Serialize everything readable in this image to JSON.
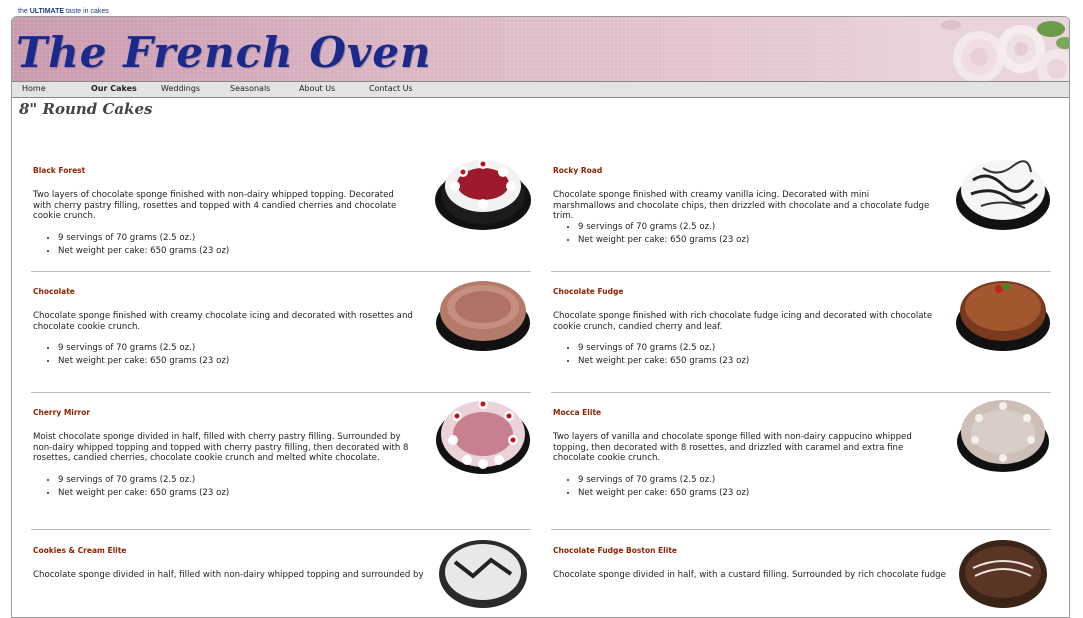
{
  "site": {
    "tagline_pre": "the ",
    "tagline_strong": "ULTIMATE",
    "tagline_post": " taste in cakes",
    "logo": "The French Oven"
  },
  "nav": [
    {
      "label": "Home",
      "active": false
    },
    {
      "label": "Our Cakes",
      "active": true
    },
    {
      "label": "Weddings",
      "active": false
    },
    {
      "label": "Seasonals",
      "active": false
    },
    {
      "label": "About Us",
      "active": false
    },
    {
      "label": "Contact Us",
      "active": false
    }
  ],
  "page_title": "8\" Round Cakes",
  "cakes": [
    {
      "name": "Black Forest",
      "desc": "Two layers of chocolate sponge finished with non-dairy whipped topping. Decorated with cherry pastry filling, rosettes and topped with 4 candied cherries and chocolate cookie crunch.",
      "servings": "9 servings of 70 grams (2.5 oz.)",
      "weight": "Net weight per cake: 650 grams (23 oz)"
    },
    {
      "name": "Rocky Road",
      "desc": "Chocolate sponge finished with creamy vanilla icing. Decorated with mini marshmallows and chocolate chips, then drizzled with chocolate and a chocolate fudge trim.",
      "servings": "9 servings of 70 grams (2.5 oz.)",
      "weight": "Net weight per cake: 650 grams (23 oz)"
    },
    {
      "name": "Chocolate",
      "desc": "Chocolate sponge finished with creamy chocolate icing and decorated with rosettes and chocolate cookie crunch.",
      "servings": "9 servings of 70 grams (2.5 oz.)",
      "weight": "Net weight per cake: 650 grams (23 oz)"
    },
    {
      "name": "Chocolate Fudge",
      "desc": "Chocolate sponge finished with rich chocolate fudge icing and decorated with chocolate cookie crunch, candied cherry and leaf.",
      "servings": "9 servings of 70 grams (2.5 oz.)",
      "weight": "Net weight per cake: 650 grams (23 oz)"
    },
    {
      "name": "Cherry Mirror",
      "desc": "Moist chocolate sponge divided in half, filled with cherry pastry filling. Surrounded by non-dairy whipped topping and topped with cherry pastry filling, then decorated with 8 rosettes, candied cherries, chocolate cookie crunch and melted white chocolate.",
      "servings": "9 servings of 70 grams (2.5 oz.)",
      "weight": "Net weight per cake: 650 grams (23 oz)"
    },
    {
      "name": "Mocca Elite",
      "desc": "Two layers of vanilla and chocolate sponge filled with non-dairy cappucino whipped topping, then decorated with 8 rosettes, and drizzled with caramel and extra fine chocolate cookie crunch.",
      "servings": "9 servings of 70 grams (2.5 oz.)",
      "weight": "Net weight per cake: 650 grams (23 oz)"
    },
    {
      "name": "Cookies & Cream Elite",
      "desc": "Chocolate sponge divided in half, filled with non-dairy whipped topping and surrounded by",
      "servings": "",
      "weight": ""
    },
    {
      "name": "Chocolate Fudge Boston Elite",
      "desc": "Chocolate sponge divided in half, with a custard filling. Surrounded by rich chocolate fudge",
      "servings": "",
      "weight": ""
    }
  ],
  "colors": {
    "cake_name": "#8b2500",
    "logo": "#1a2a8c",
    "nav_bg": "#e3e3e3"
  }
}
